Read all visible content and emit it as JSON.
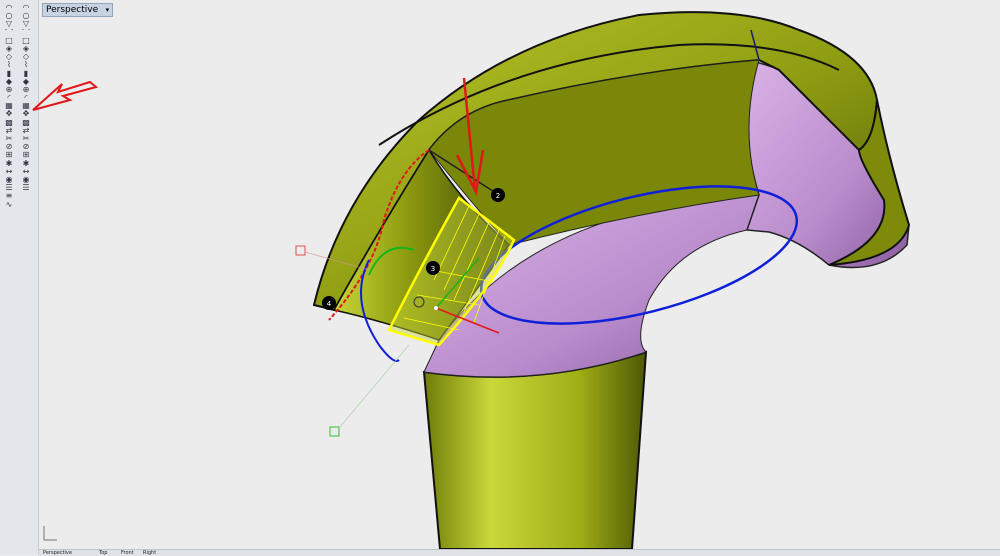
{
  "viewport": {
    "label": "Perspective",
    "menu_icon": "chevron-down-icon"
  },
  "toolbar": {
    "left_column": [
      "curve-tool-icon",
      "circle-tool-icon",
      "polyline-icon",
      "arc-icon",
      "rectangle-icon",
      "surface-icon",
      "loft-icon",
      "sweep-icon",
      "extrude-icon",
      "solid-icon",
      "boolean-icon",
      "fillet-icon",
      "mesh-icon",
      "transform-icon",
      "array-icon",
      "mirror-icon",
      "trim-icon",
      "split-icon",
      "join-icon",
      "explode-icon",
      "dimension-icon",
      "render-icon",
      "layer-icon",
      "properties-icon",
      "analyze-icon"
    ],
    "right_column": [
      "point-icon",
      "line-icon",
      "offset-icon",
      "polygon-icon",
      "helix-icon",
      "patch-icon",
      "network-icon",
      "revolve-icon",
      "blend-surface-icon",
      "match-surface-icon",
      "fillet-edge-icon",
      "chamfer-icon",
      "cap-icon",
      "shell-icon",
      "move-icon",
      "rotate-icon",
      "scale-icon",
      "orient-icon",
      "project-icon",
      "intersect-icon",
      "text-icon",
      "check-icon",
      "snap-icon"
    ]
  },
  "annotations": {
    "markers": [
      "2",
      "3",
      "4"
    ]
  },
  "bottom_tabs": [
    "Perspective",
    "Top",
    "Front",
    "Right"
  ],
  "colors": {
    "surface": "#a8b81c",
    "surface_dark": "#5a6608",
    "interior": "#c99fd8",
    "selection": "#ffff00",
    "curve_blue": "#1020d8",
    "arrow_red": "#e01818"
  }
}
